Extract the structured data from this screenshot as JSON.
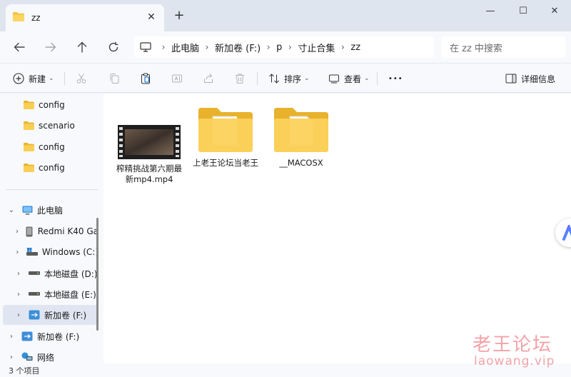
{
  "tab": {
    "title": "zz",
    "close": "✕",
    "add": "+"
  },
  "window": {
    "minimize": "—",
    "maximize": "☐",
    "close": "✕"
  },
  "breadcrumb": [
    "此电脑",
    "新加卷 (F:)",
    "p",
    "寸止合集",
    "zz"
  ],
  "search": {
    "placeholder": "在 zz 中搜索"
  },
  "toolbar": {
    "new_label": "新建",
    "sort_label": "排序",
    "view_label": "查看",
    "more_label": "•••",
    "details_label": "详细信息"
  },
  "sidebar": {
    "items": [
      {
        "label": "config"
      },
      {
        "label": "scenario"
      },
      {
        "label": "config"
      },
      {
        "label": "config"
      },
      {
        "label": "此电脑"
      },
      {
        "label": "Redmi K40 Ga"
      },
      {
        "label": "Windows (C:)"
      },
      {
        "label": "本地磁盘 (D:)"
      },
      {
        "label": "本地磁盘 (E:)"
      },
      {
        "label": "新加卷 (F:)"
      },
      {
        "label": "新加卷 (F:)"
      },
      {
        "label": "网络"
      }
    ]
  },
  "files": [
    {
      "name": "榨精挑战第六期最新mp4.mp4",
      "type": "video"
    },
    {
      "name": "上老王论坛当老王",
      "type": "folder"
    },
    {
      "name": "__MACOSX",
      "type": "folder"
    }
  ],
  "status": {
    "count": "3 个项目"
  },
  "watermark": {
    "cn": "老王论坛",
    "en": "laowang.vip"
  },
  "colors": {
    "accent": "#0067c0",
    "folder": "#f5c342",
    "selected": "#dfe6f1",
    "watermark": "#f2a3a8"
  }
}
